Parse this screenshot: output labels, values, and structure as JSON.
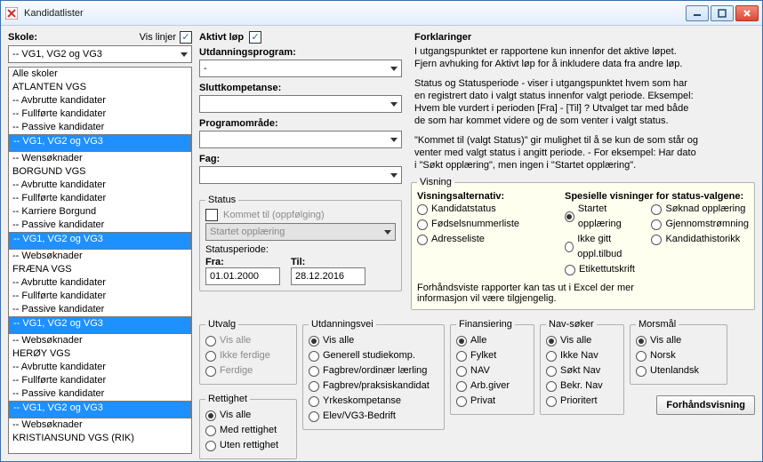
{
  "window": {
    "title": "Kandidatlister"
  },
  "left": {
    "skole_label": "Skole:",
    "vis_linjer_label": "Vis linjer",
    "vis_linjer_checked": true,
    "skole_value": "-- VG1, VG2 og VG3",
    "items": [
      {
        "t": "Alle skoler"
      },
      {
        "t": "ATLANTEN VGS"
      },
      {
        "t": "-- Avbrutte kandidater"
      },
      {
        "t": "-- Fullførte kandidater"
      },
      {
        "t": "-- Passive kandidater"
      },
      {
        "t": "-- VG1, VG2 og VG3",
        "sel": true
      },
      {
        "t": "-- Wensøknader"
      },
      {
        "t": "BORGUND VGS"
      },
      {
        "t": "-- Avbrutte kandidater"
      },
      {
        "t": "-- Fullførte kandidater"
      },
      {
        "t": "-- Karriere Borgund"
      },
      {
        "t": "-- Passive kandidater"
      },
      {
        "t": "-- VG1, VG2 og VG3",
        "sel": true
      },
      {
        "t": "-- Websøknader"
      },
      {
        "t": "FRÆNA VGS"
      },
      {
        "t": "-- Avbrutte kandidater"
      },
      {
        "t": "-- Fullførte kandidater"
      },
      {
        "t": "-- Passive kandidater"
      },
      {
        "t": "-- VG1, VG2 og VG3",
        "sel": true
      },
      {
        "t": "-- Websøknader"
      },
      {
        "t": "HERØY VGS"
      },
      {
        "t": "-- Avbrutte kandidater"
      },
      {
        "t": "-- Fullførte kandidater"
      },
      {
        "t": "-- Passive kandidater"
      },
      {
        "t": "-- VG1, VG2 og VG3",
        "sel": true
      },
      {
        "t": "-- Websøknader"
      },
      {
        "t": "KRISTIANSUND VGS (RIK)"
      }
    ]
  },
  "mid": {
    "aktivt_lop_label": "Aktivt løp",
    "aktivt_lop_checked": true,
    "utdanningsprogram_label": "Utdanningsprogram:",
    "utdanningsprogram_value": "-",
    "sluttkompetanse_label": "Sluttkompetanse:",
    "programomrade_label": "Programområde:",
    "fag_label": "Fag:",
    "status_legend": "Status",
    "kommet_til_label": "Kommet til (oppfølging)",
    "kommet_til_checked": false,
    "status_value": "Startet opplæring",
    "statusperiode_label": "Statusperiode:",
    "fra_label": "Fra:",
    "fra_value": "01.01.2000",
    "til_label": "Til:",
    "til_value": "28.12.2016"
  },
  "explain": {
    "hdr": "Forklaringer",
    "p1a": "I utgangspunktet er rapportene kun innenfor det aktive løpet.",
    "p1b": "Fjern avhuking for Aktivt løp for å inkludere data fra andre løp.",
    "p2a": "Status og Statusperiode - viser i utgangspunktet hvem som har",
    "p2b": "en registrert dato i valgt status innenfor valgt periode. Eksempel:",
    "p2c": "Hvem ble vurdert i perioden [Fra] - [Til] ? Utvalget tar med både",
    "p2d": "de som har kommet videre og de som venter i valgt status.",
    "p3a": "\"Kommet til (valgt Status)\" gir mulighet til å se kun de som står og",
    "p3b": "venter med valgt status i angitt periode. - For eksempel: Har dato",
    "p3c": "i \"Søkt opplæring\", men ingen i \"Startet opplæring\"."
  },
  "visning": {
    "legend": "Visning",
    "alt_label": "Visningsalternativ:",
    "alt": [
      "Kandidatstatus",
      "Fødselsnummerliste",
      "Adresseliste"
    ],
    "alt_selected": -1,
    "spes_label": "Spesielle visninger for status-valgene:",
    "spesA": [
      "Startet opplæring",
      "Ikke gitt oppl.tilbud",
      "Etikettutskrift"
    ],
    "spesA_selected": 0,
    "spesB": [
      "Søknad opplæring",
      "Gjennomstrømning",
      "Kandidathistorikk"
    ],
    "spesB_selected": -1,
    "note1": "Forhåndsviste rapporter kan tas ut i Excel der mer",
    "note2": "informasjon vil være tilgjengelig."
  },
  "bottom": {
    "utvalg": {
      "legend": "Utvalg",
      "items": [
        "Vis alle",
        "Ikke ferdige",
        "Ferdige"
      ],
      "selected": -1,
      "disabled": true
    },
    "rettighet": {
      "legend": "Rettighet",
      "items": [
        "Vis alle",
        "Med rettighet",
        "Uten rettighet"
      ],
      "selected": 0
    },
    "utdvei": {
      "legend": "Utdanningsvei",
      "items": [
        "Vis alle",
        "Generell studiekomp.",
        "Fagbrev/ordinær lærling",
        "Fagbrev/praksiskandidat",
        "Yrkeskompetanse",
        "Elev/VG3-Bedrift"
      ],
      "selected": 0
    },
    "finans": {
      "legend": "Finansiering",
      "items": [
        "Alle",
        "Fylket",
        "NAV",
        "Arb.giver",
        "Privat"
      ],
      "selected": 0
    },
    "navsoker": {
      "legend": "Nav-søker",
      "items": [
        "Vis alle",
        "Ikke Nav",
        "Søkt Nav",
        "Bekr. Nav",
        "Prioritert"
      ],
      "selected": 0
    },
    "morsmal": {
      "legend": "Morsmål",
      "items": [
        "Vis alle",
        "Norsk",
        "Utenlandsk"
      ],
      "selected": 0
    },
    "preview_btn": "Forhåndsvisning"
  }
}
